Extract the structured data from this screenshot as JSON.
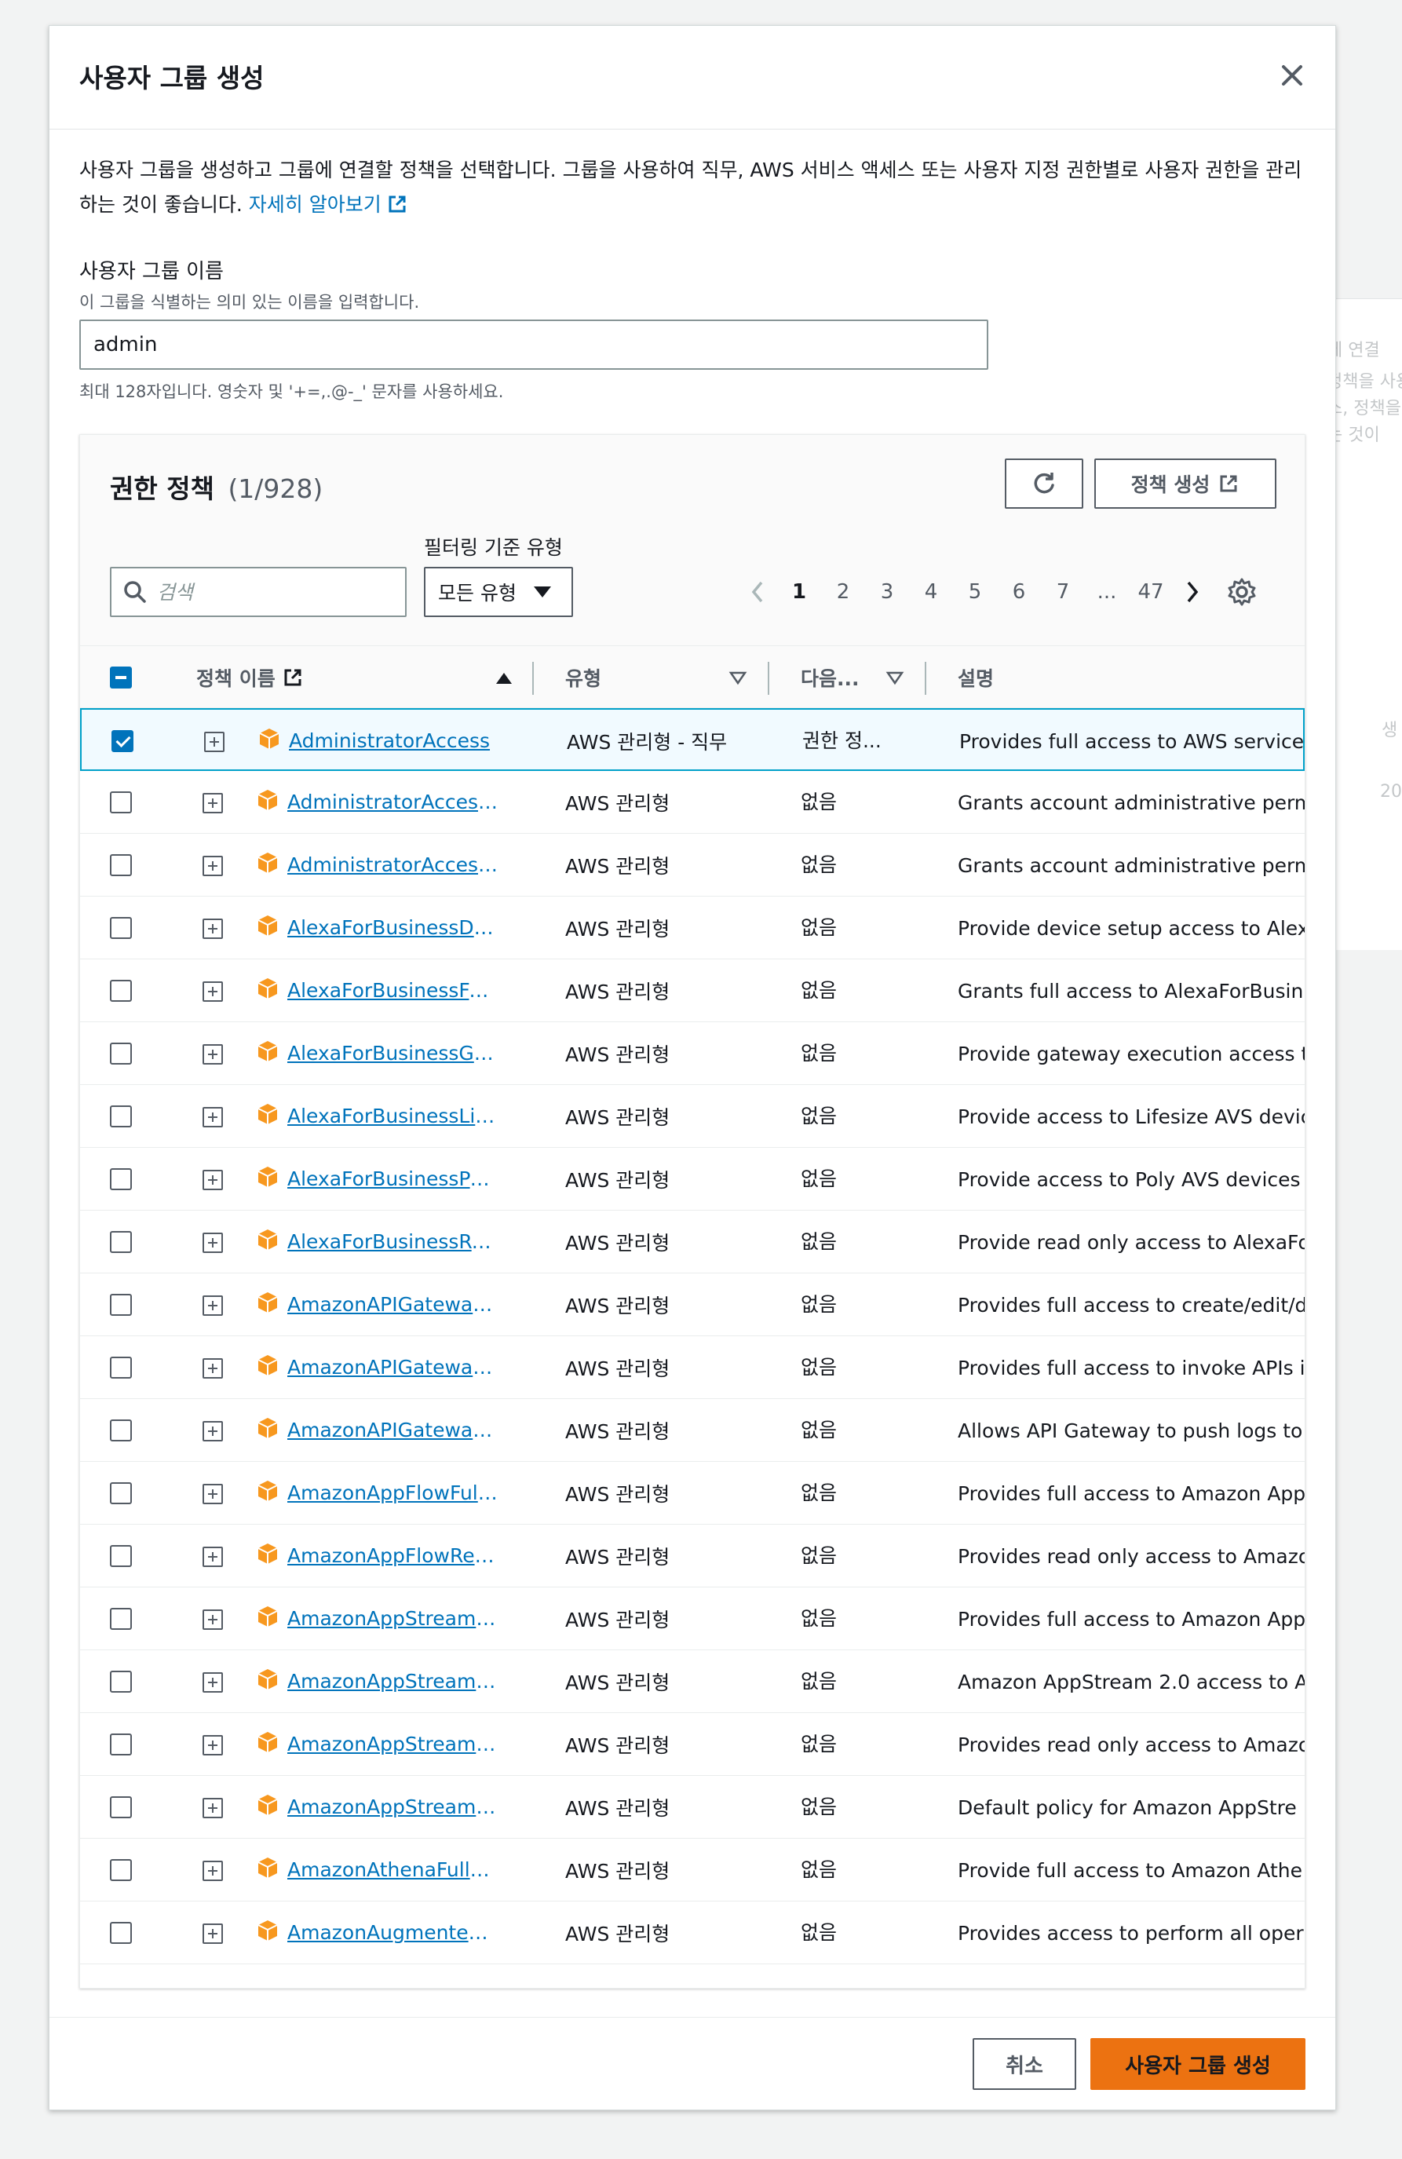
{
  "background": {
    "texts": [
      "에 연결",
      "정책을 사용",
      "스, 정책을",
      "는 것이",
      "생",
      "20"
    ]
  },
  "modal": {
    "title": "사용자 그룹 생성",
    "description": "사용자 그룹을 생성하고 그룹에 연결할 정책을 선택합니다. 그룹을 사용하여 직무, AWS 서비스 액세스 또는 사용자 지정 권한별로 사용자 권한을 관리하는 것이 좋습니다.",
    "learn_more": "자세히 알아보기"
  },
  "group_name": {
    "label": "사용자 그룹 이름",
    "hint": "이 그룹을 식별하는 의미 있는 이름을 입력합니다.",
    "value": "admin",
    "constraint": "최대 128자입니다. 영숫자 및 '+=,.@-_' 문자를 사용하세요."
  },
  "policies": {
    "title": "권한 정책",
    "count": "(1/928)",
    "create_policy": "정책 생성",
    "filter_label": "필터링 기준 유형",
    "search_placeholder": "검색",
    "type_selected": "모든 유형",
    "pagination": {
      "pages": [
        "1",
        "2",
        "3",
        "4",
        "5",
        "6",
        "7",
        "...",
        "47"
      ],
      "current": "1"
    },
    "columns": {
      "name": "정책 이름",
      "type": "유형",
      "used_as": "다음...",
      "description": "설명"
    },
    "rows": [
      {
        "name": "AdministratorAccess",
        "type": "AWS 관리형 - 직무",
        "used": "권한 정...",
        "desc": "Provides full access to AWS services",
        "checked": true
      },
      {
        "name": "AdministratorAccess-Amplify",
        "type": "AWS 관리형",
        "used": "없음",
        "desc": "Grants account administrative perm",
        "checked": false
      },
      {
        "name": "AdministratorAccess-AWSElasticBeanstalk",
        "type": "AWS 관리형",
        "used": "없음",
        "desc": "Grants account administrative perm",
        "checked": false
      },
      {
        "name": "AlexaForBusinessDeviceSetup",
        "type": "AWS 관리형",
        "used": "없음",
        "desc": "Provide device setup access to Alex",
        "checked": false
      },
      {
        "name": "AlexaForBusinessFullAccess",
        "type": "AWS 관리형",
        "used": "없음",
        "desc": "Grants full access to AlexaForBusin",
        "checked": false
      },
      {
        "name": "AlexaForBusinessGatewayExecution",
        "type": "AWS 관리형",
        "used": "없음",
        "desc": "Provide gateway execution access t",
        "checked": false
      },
      {
        "name": "AlexaForBusinessLifesizeDelegatedAccessPolicy",
        "type": "AWS 관리형",
        "used": "없음",
        "desc": "Provide access to Lifesize AVS devic",
        "checked": false
      },
      {
        "name": "AlexaForBusinessPolyDelegatedAccessPolicy",
        "type": "AWS 관리형",
        "used": "없음",
        "desc": "Provide access to Poly AVS devices",
        "checked": false
      },
      {
        "name": "AlexaForBusinessReadOnlyAccess",
        "type": "AWS 관리형",
        "used": "없음",
        "desc": "Provide read only access to AlexaFo",
        "checked": false
      },
      {
        "name": "AmazonAPIGatewayAdministrator",
        "type": "AWS 관리형",
        "used": "없음",
        "desc": "Provides full access to create/edit/d",
        "checked": false
      },
      {
        "name": "AmazonAPIGatewayInvokeFullAccess",
        "type": "AWS 관리형",
        "used": "없음",
        "desc": "Provides full access to invoke APIs i",
        "checked": false
      },
      {
        "name": "AmazonAPIGatewayPushToCloudWatchLogs",
        "type": "AWS 관리형",
        "used": "없음",
        "desc": "Allows API Gateway to push logs to",
        "checked": false
      },
      {
        "name": "AmazonAppFlowFullAccess",
        "type": "AWS 관리형",
        "used": "없음",
        "desc": "Provides full access to Amazon App",
        "checked": false
      },
      {
        "name": "AmazonAppFlowReadOnlyAccess",
        "type": "AWS 관리형",
        "used": "없음",
        "desc": "Provides read only access to Amazo",
        "checked": false
      },
      {
        "name": "AmazonAppStreamFullAccess",
        "type": "AWS 관리형",
        "used": "없음",
        "desc": "Provides full access to Amazon App",
        "checked": false
      },
      {
        "name": "AmazonAppStreamPCAAccess",
        "type": "AWS 관리형",
        "used": "없음",
        "desc": "Amazon AppStream 2.0 access to A",
        "checked": false
      },
      {
        "name": "AmazonAppStreamReadOnlyAccess",
        "type": "AWS 관리형",
        "used": "없음",
        "desc": "Provides read only access to Amazo",
        "checked": false
      },
      {
        "name": "AmazonAppStreamServiceAccess",
        "type": "AWS 관리형",
        "used": "없음",
        "desc": "Default policy for Amazon AppStre",
        "checked": false
      },
      {
        "name": "AmazonAthenaFullAccess",
        "type": "AWS 관리형",
        "used": "없음",
        "desc": "Provide full access to Amazon Athe",
        "checked": false
      },
      {
        "name": "AmazonAugmentedAIFullAccess",
        "type": "AWS 관리형",
        "used": "없음",
        "desc": "Provides access to perform all oper",
        "checked": false
      }
    ]
  },
  "footer": {
    "cancel": "취소",
    "create": "사용자 그룹 생성"
  },
  "colors": {
    "link": "#0073bb",
    "primary": "#ec7211",
    "cube": "#f7981f"
  }
}
